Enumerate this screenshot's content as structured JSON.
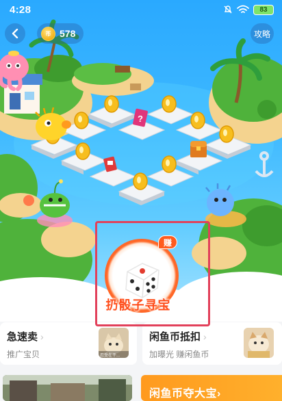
{
  "status_bar": {
    "time": "4:28",
    "battery": "83"
  },
  "header": {
    "coin_count": "578",
    "coin_symbol": "币",
    "guide_label": "攻略"
  },
  "game": {
    "dice_badge": "赚",
    "dice_label": "扔骰子寻宝"
  },
  "cards": [
    {
      "title": "急速卖",
      "subtitle": "推广宝贝",
      "thumb_caption": "忍受在干..."
    },
    {
      "title": "闲鱼币抵扣",
      "subtitle": "加曝光 赚闲鱼币"
    }
  ],
  "banner": {
    "label": "闲鱼币夺大宝›"
  },
  "colors": {
    "sky": "#2aa9ff",
    "accent_orange": "#ff5b1e",
    "highlight_border": "#e2405a",
    "coin_gold": "#f3b21b"
  },
  "icons": {
    "status": [
      "bell-off-icon",
      "wifi-icon",
      "battery-icon"
    ],
    "nav": [
      "back-arrow-icon",
      "coin-icon"
    ],
    "board": [
      "octopus-icon",
      "pufferfish-icon",
      "anglerfish-icon",
      "blowfish-icon",
      "mystery-card-icon",
      "treasure-chest-icon",
      "red-flag-card-icon",
      "dice-icon"
    ]
  }
}
